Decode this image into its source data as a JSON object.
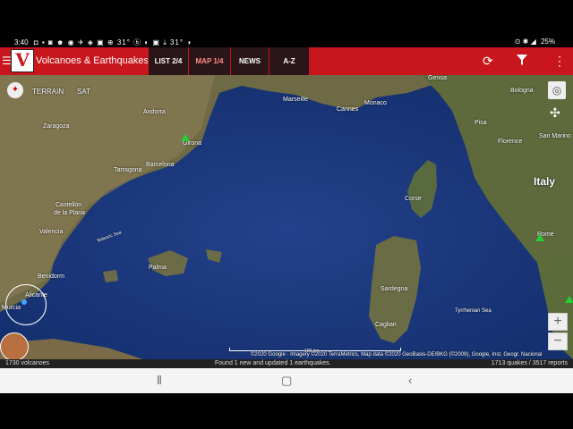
{
  "status": {
    "time": "3:40",
    "left_icons": "◘ ▪ ◙ ☻ ◉ ✈ ◈ ▣ ⊕ 31° ⓑ ◐ ▣ ⤓ 31° ◑",
    "battery": "25%",
    "right_icons": "⊙ ✱ ◢"
  },
  "appbar": {
    "title": "Volcanoes & Earthquakes",
    "logo_letter": "V",
    "tabs": [
      {
        "label": "LIST 2/4"
      },
      {
        "label": "MAP 1/4"
      },
      {
        "label": "NEWS"
      },
      {
        "label": "A-Z"
      }
    ]
  },
  "map": {
    "terrain": "TERRAIN",
    "sat": "SAT",
    "labels": {
      "andorra": "Andorra",
      "zaragoza": "Zaragoza",
      "girona": "Girona",
      "tarragona": "Tarragona",
      "barcelona": "Barcelona",
      "castellon": "Castellón",
      "delaplana": "de la Plana",
      "valencia": "Valencia",
      "palma": "Palma",
      "benidorm": "Benidorm",
      "alicante": "Alicante",
      "murcia": "Murcia",
      "marseille": "Marseille",
      "cannes": "Cannes",
      "monaco": "Monaco",
      "genoa": "Genoa",
      "bologna": "Bologna",
      "pisa": "Pisa",
      "florence": "Florence",
      "sanmarino": "San Marino",
      "italy": "Italy",
      "rome": "Rome",
      "corse": "Corse",
      "sardegna": "Sardegna",
      "cagliari": "Cagliari",
      "tyrrhenian": "Tyrrhenian Sea",
      "balearic": "Balearic Sea"
    },
    "attribution": "©2020 Google · Imagery ©2020 TerraMetrics, Map data ©2020 GeoBasis-DE/BKG (©2009), Google, Inst. Geogr. Nacional",
    "scale": "100 km",
    "zoom_in": "+",
    "zoom_out": "−"
  },
  "footer": {
    "volcanoes": "1730 volcanoes",
    "message": "Found 1 new and updated 1 earthquakes.",
    "counts": "1713 quakes / 3517 reports"
  }
}
